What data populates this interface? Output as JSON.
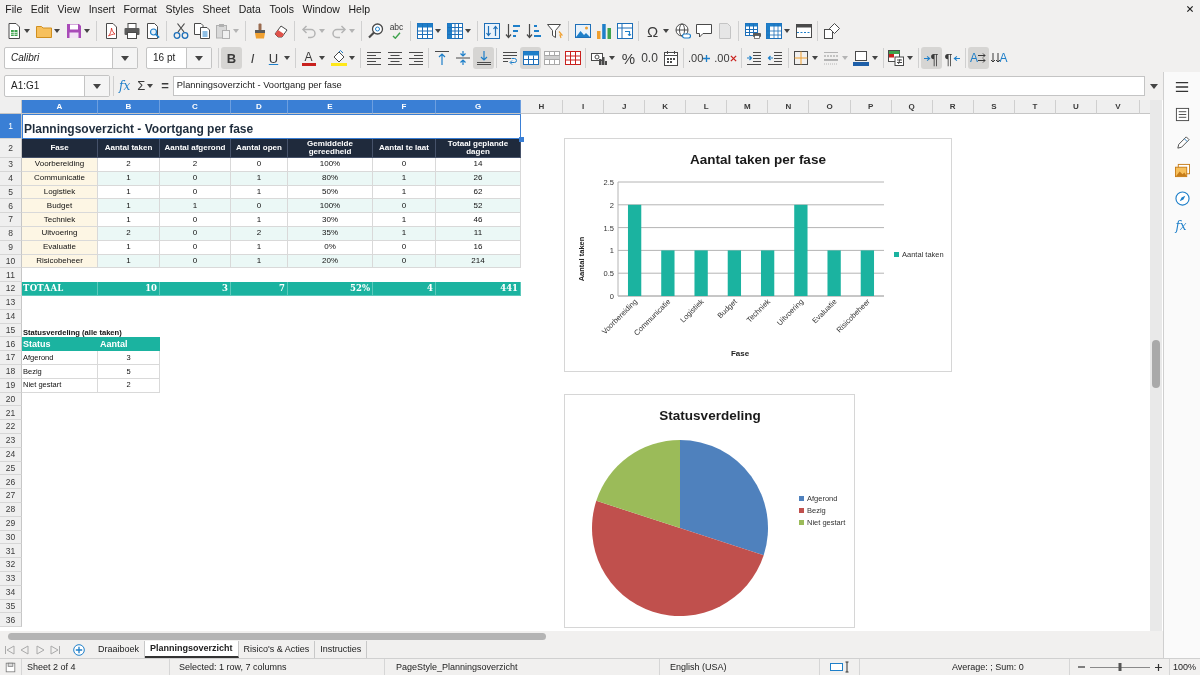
{
  "menu": [
    "File",
    "Edit",
    "View",
    "Insert",
    "Format",
    "Styles",
    "Sheet",
    "Data",
    "Tools",
    "Window",
    "Help"
  ],
  "standard_toolbar": {
    "spelling_label": "abc",
    "special_character_label": "Ω"
  },
  "format_toolbar": {
    "font_name": "Calibri",
    "font_size": "16 pt",
    "bold_label": "B",
    "bold": true,
    "italic_label": "I",
    "italic": false,
    "underline_label": "U",
    "underline": false,
    "font_color_label": "A",
    "align_top": false,
    "align_middle": false,
    "align_bottom": true,
    "merge_center": true,
    "percent_label": "%",
    "number_label": "0.0",
    "add_decimal_label": ".00",
    "delete_decimal_label": ".00",
    "ltr_label": "¶",
    "left_to_right": true,
    "rtl_label": "¶",
    "right_to_left": false,
    "horizontal_text_label": "A",
    "horizontal_text": true,
    "vertical_text_label": "A",
    "vertical_text": false
  },
  "formula_bar": {
    "name_box": "A1:G1",
    "function_label": "fx",
    "sum_label": "Σ",
    "equals_label": "=",
    "content": "Planningsoverzicht - Voortgang per fase"
  },
  "sidebar": {
    "functions_label": "fx"
  },
  "sheet": {
    "column_headers": [
      {
        "label": "A",
        "selected": true
      },
      {
        "label": "B",
        "selected": true
      },
      {
        "label": "C",
        "selected": true
      },
      {
        "label": "D",
        "selected": true
      },
      {
        "label": "E",
        "selected": true
      },
      {
        "label": "F",
        "selected": true
      },
      {
        "label": "G",
        "selected": true
      },
      {
        "label": "H",
        "selected": false
      },
      {
        "label": "I",
        "selected": false
      },
      {
        "label": "J",
        "selected": false
      },
      {
        "label": "K",
        "selected": false
      },
      {
        "label": "L",
        "selected": false
      },
      {
        "label": "M",
        "selected": false
      },
      {
        "label": "N",
        "selected": false
      },
      {
        "label": "O",
        "selected": false
      },
      {
        "label": "P",
        "selected": false
      },
      {
        "label": "Q",
        "selected": false
      },
      {
        "label": "R",
        "selected": false
      },
      {
        "label": "S",
        "selected": false
      },
      {
        "label": "T",
        "selected": false
      },
      {
        "label": "U",
        "selected": false
      },
      {
        "label": "V",
        "selected": false
      }
    ],
    "row_headers": [
      {
        "label": "1",
        "selected": true
      },
      {
        "label": "2",
        "selected": false
      },
      {
        "label": "3",
        "selected": false
      },
      {
        "label": "4",
        "selected": false
      },
      {
        "label": "5",
        "selected": false
      },
      {
        "label": "6",
        "selected": false
      },
      {
        "label": "7",
        "selected": false
      },
      {
        "label": "8",
        "selected": false
      },
      {
        "label": "9",
        "selected": false
      },
      {
        "label": "10",
        "selected": false
      },
      {
        "label": "11",
        "selected": false
      },
      {
        "label": "12",
        "selected": false
      },
      {
        "label": "13",
        "selected": false
      },
      {
        "label": "14",
        "selected": false
      },
      {
        "label": "15",
        "selected": false
      },
      {
        "label": "16",
        "selected": false
      },
      {
        "label": "17",
        "selected": false
      },
      {
        "label": "18",
        "selected": false
      },
      {
        "label": "19",
        "selected": false
      },
      {
        "label": "20",
        "selected": false
      },
      {
        "label": "21",
        "selected": false
      },
      {
        "label": "22",
        "selected": false
      },
      {
        "label": "23",
        "selected": false
      },
      {
        "label": "24",
        "selected": false
      },
      {
        "label": "25",
        "selected": false
      },
      {
        "label": "26",
        "selected": false
      },
      {
        "label": "27",
        "selected": false
      },
      {
        "label": "28",
        "selected": false
      },
      {
        "label": "29",
        "selected": false
      },
      {
        "label": "30",
        "selected": false
      },
      {
        "label": "31",
        "selected": false
      },
      {
        "label": "32",
        "selected": false
      },
      {
        "label": "33",
        "selected": false
      },
      {
        "label": "34",
        "selected": false
      },
      {
        "label": "35",
        "selected": false
      },
      {
        "label": "36",
        "selected": false
      }
    ],
    "title": {
      "text": "Planningsoverzicht - Voortgang per fase",
      "selected": true
    },
    "phase_table": {
      "columns": [
        "Fase",
        "Aantal taken",
        "Aantal afgerond",
        "Aantal open",
        "Gemiddelde gereedheid",
        "Aantal te laat",
        "Totaal geplande dagen"
      ],
      "rows": [
        [
          "Voorbereiding",
          "2",
          "2",
          "0",
          "100%",
          "0",
          "14"
        ],
        [
          "Communicatie",
          "1",
          "0",
          "1",
          "80%",
          "1",
          "26"
        ],
        [
          "Logistiek",
          "1",
          "0",
          "1",
          "50%",
          "1",
          "62"
        ],
        [
          "Budget",
          "1",
          "1",
          "0",
          "100%",
          "0",
          "52"
        ],
        [
          "Techniek",
          "1",
          "0",
          "1",
          "30%",
          "1",
          "46"
        ],
        [
          "Uitvoering",
          "2",
          "0",
          "2",
          "35%",
          "1",
          "11"
        ],
        [
          "Evaluatie",
          "1",
          "0",
          "1",
          "0%",
          "0",
          "16"
        ],
        [
          "Risicobeheer",
          "1",
          "0",
          "1",
          "20%",
          "0",
          "214"
        ]
      ],
      "total": [
        "TOTAAL",
        "10",
        "3",
        "7",
        "52%",
        "4",
        "441"
      ]
    },
    "status_table": {
      "title": "Statusverdeling (alle taken)",
      "columns": [
        "Status",
        "Aantal"
      ],
      "rows": [
        [
          "Afgerond",
          "3"
        ],
        [
          "Bezig",
          "5"
        ],
        [
          "Niet gestart",
          "2"
        ]
      ]
    },
    "charts": [
      {
        "chart_data": {
          "type": "bar",
          "title": "Aantal taken per fase",
          "xlabel": "Fase",
          "ylabel": "Aantal taken",
          "categories": [
            "Voorbereiding",
            "Communicatie",
            "Logistiek",
            "Budget",
            "Techniek",
            "Uitvoering",
            "Evaluatie",
            "Risicobeheer"
          ],
          "series": [
            {
              "name": "Aantal taken",
              "color": "#1bb3a0",
              "values": [
                2,
                1,
                1,
                1,
                1,
                2,
                1,
                1
              ]
            }
          ],
          "ylim": [
            0,
            2.5
          ],
          "yticks": [
            {
              "value": 0,
              "label": "0"
            },
            {
              "value": 0.5,
              "label": "0.5"
            },
            {
              "value": 1,
              "label": "1"
            },
            {
              "value": 1.5,
              "label": "1.5"
            },
            {
              "value": 2,
              "label": "2"
            },
            {
              "value": 2.5,
              "label": "2.5"
            }
          ],
          "grid": true,
          "legend": true
        }
      },
      {
        "chart_data": {
          "type": "pie",
          "title": "Statusverdeling",
          "categories": [
            "Afgerond",
            "Bezig",
            "Niet gestart"
          ],
          "values": [
            30,
            50,
            20
          ],
          "colors": [
            "#4f81bd",
            "#c0504d",
            "#9bbb59"
          ],
          "legend": true
        }
      }
    ]
  },
  "sheet_tabs": [
    {
      "label": "Draaiboek",
      "selected": false
    },
    {
      "label": "Planningsoverzicht",
      "selected": true
    },
    {
      "label": "Risico's & Acties",
      "selected": false
    },
    {
      "label": "Instructies",
      "selected": false
    }
  ],
  "status_bar": {
    "sheet": "Sheet 2 of 4",
    "selection": "Selected: 1 row, 7 columns",
    "page_style": "PageStyle_Planningsoverzicht",
    "language": "English (USA)",
    "summary": "Average: ; Sum: 0",
    "zoom_slider": {
      "level": 0.5
    },
    "zoom": "100%"
  }
}
